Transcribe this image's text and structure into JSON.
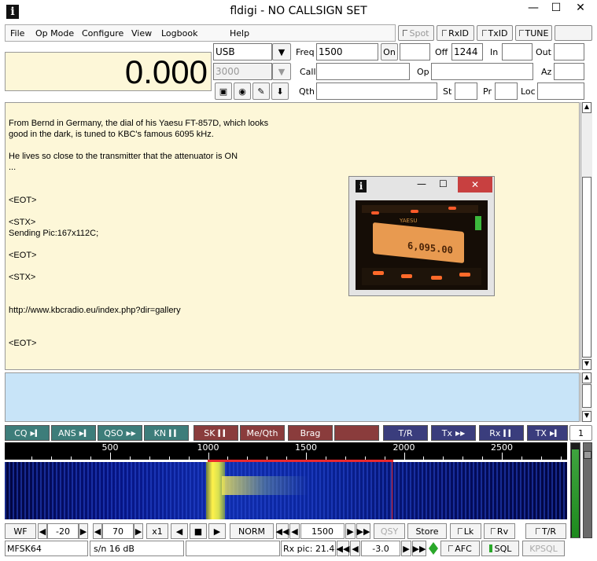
{
  "window": {
    "title": "fldigi - NO CALLSIGN SET",
    "icon": "i",
    "min": "—",
    "max": "☐",
    "close": "✕"
  },
  "menu": [
    "File",
    "Op Mode",
    "Configure",
    "View",
    "Logbook",
    "Help"
  ],
  "toggles": {
    "spot": "Spot",
    "rxid": "RxID",
    "txid": "TxID",
    "tune": "TUNE"
  },
  "freq_display": "0.000",
  "mode": "USB",
  "bandwidth": "3000",
  "fields": {
    "freq_label": "Freq",
    "freq": "1500",
    "on_label": "On",
    "off_label": "Off",
    "off": "1244",
    "in_label": "In",
    "out_label": "Out",
    "call_label": "Call",
    "op_label": "Op",
    "az_label": "Az",
    "qth_label": "Qth",
    "st_label": "St",
    "pr_label": "Pr",
    "loc_label": "Loc"
  },
  "rx_text": [
    "From Bernd in Germany, the dial of his Yaesu FT-857D, which looks",
    "good in the dark, is tuned to KBC's famous 6095 kHz.",
    "",
    "He lives so close to the transmitter that the attenuator is ON",
    "...",
    "",
    "",
    "<EOT>",
    "",
    "<STX>",
    "Sending Pic:167x112C;",
    "",
    "<EOT>",
    "",
    "<STX>",
    "",
    "",
    "http://www.kbcradio.eu/index.php?dir=gallery",
    "",
    "",
    "<EOT>"
  ],
  "pic_window": {
    "icon": "i",
    "min": "—",
    "max": "☐",
    "close": "✕",
    "brand": "YAESU",
    "readout": "6,095.00"
  },
  "macros": [
    {
      "label": "CQ",
      "glyph": "▶▍",
      "color": "#3d7d7a"
    },
    {
      "label": "ANS",
      "glyph": "▶▍",
      "color": "#3d7d7a"
    },
    {
      "label": "QSO",
      "glyph": "▶▶",
      "color": "#3d7d7a"
    },
    {
      "label": "KN",
      "glyph": "▍▍",
      "color": "#3d7d7a"
    },
    {
      "label": "SK",
      "glyph": "▍▍",
      "color": "#8a3c3c"
    },
    {
      "label": "Me/Qth",
      "glyph": "",
      "color": "#8a3c3c"
    },
    {
      "label": "Brag",
      "glyph": "",
      "color": "#8a3c3c"
    },
    {
      "label": "",
      "glyph": "",
      "color": "#8a3c3c"
    },
    {
      "label": "T/R",
      "glyph": "",
      "color": "#3a3d7d"
    },
    {
      "label": "Tx",
      "glyph": "▶▶",
      "color": "#3a3d7d"
    },
    {
      "label": "Rx",
      "glyph": "▍▍",
      "color": "#3a3d7d"
    },
    {
      "label": "TX",
      "glyph": "▶▍",
      "color": "#3a3d7d"
    }
  ],
  "macro_set": "1",
  "scale": {
    "ticks": [
      "500",
      "1000",
      "1500",
      "2000",
      "2500"
    ]
  },
  "wf": {
    "mode": "WF",
    "ref": "-20",
    "range": "70",
    "zoom": "x1",
    "speed": "NORM",
    "freq": "1500",
    "qsy": "QSY",
    "store": "Store",
    "lk": "Lk",
    "rv": "Rv",
    "tr": "T/R"
  },
  "status": {
    "mode": "MFSK64",
    "sn": "s/n  16 dB",
    "rxpic": "Rx pic: 21.4",
    "imd": "-3.0",
    "afc": "AFC",
    "sql": "SQL",
    "kpsql": "KPSQL"
  }
}
